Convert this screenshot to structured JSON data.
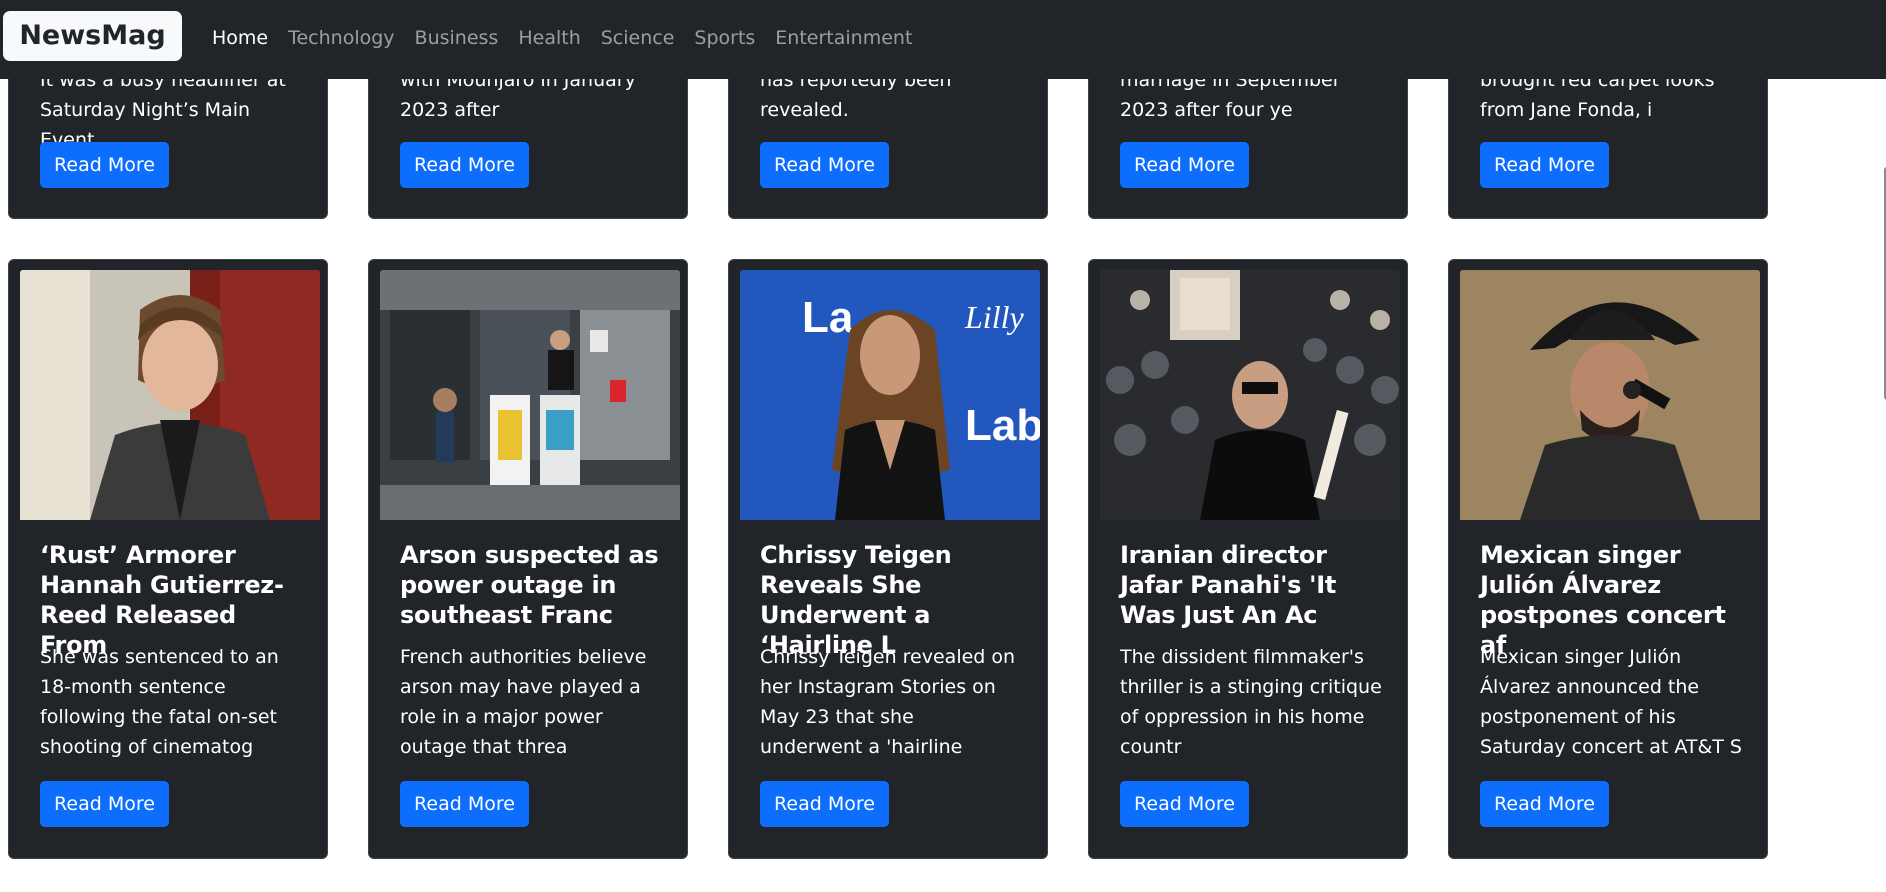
{
  "navbar": {
    "brand": "NewsMag",
    "links": [
      "Home",
      "Technology",
      "Business",
      "Health",
      "Science",
      "Sports",
      "Entertainment"
    ],
    "active": "Home"
  },
  "top_cards": [
    {
      "text": "It was a busy headliner at Saturday Night’s Main Event.",
      "button": "Read More"
    },
    {
      "text": "with Mounjaro in January 2023 after",
      "button": "Read More"
    },
    {
      "text": "has reportedly been revealed.",
      "button": "Read More"
    },
    {
      "text": "marriage in September 2023 after four ye",
      "button": "Read More"
    },
    {
      "text": "brought red carpet looks from Jane Fonda, i",
      "button": "Read More"
    }
  ],
  "cards": [
    {
      "title": "‘Rust’ Armorer Hannah Gutierrez-Reed Released From",
      "text": "She was sentenced to an 18-month sentence following the fatal on-set shooting of cinematog",
      "button": "Read More",
      "image_icon": "portrait-woman-photo"
    },
    {
      "title": "Arson suspected as power outage in southeast Franc",
      "text": "French authorities believe arson may have played a role in a major power outage that threa",
      "button": "Read More",
      "image_icon": "street-shopfront-photo"
    },
    {
      "title": "Chrissy Teigen Reveals She Underwent a ‘Hairline L",
      "text": "Chrissy Teigen revealed on her Instagram Stories on May 23 that she underwent a 'hairline",
      "button": "Read More",
      "image_icon": "red-carpet-photo"
    },
    {
      "title": "Iranian director Jafar Panahi's 'It Was Just An Ac",
      "text": "The dissident filmmaker's thriller is a stinging critique of oppression in his home countr",
      "button": "Read More",
      "image_icon": "award-ceremony-photo"
    },
    {
      "title": "Mexican singer Julión Álvarez postpones concert af",
      "text": "Mexican singer Julión Álvarez announced the postponement of his Saturday concert at AT&T S",
      "button": "Read More",
      "image_icon": "singer-cowboy-hat-photo"
    }
  ]
}
